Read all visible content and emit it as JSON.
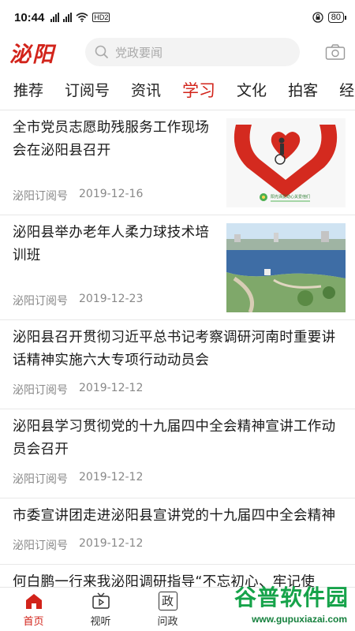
{
  "status_bar": {
    "time": "10:44",
    "network_badge": "HD2",
    "battery": "80"
  },
  "header": {
    "logo": "泌阳",
    "search_placeholder": "党政要闻",
    "camera_icon": "camera-icon"
  },
  "tabs": [
    {
      "label": "推荐",
      "active": false
    },
    {
      "label": "订阅号",
      "active": false
    },
    {
      "label": "资讯",
      "active": false
    },
    {
      "label": "学习",
      "active": true
    },
    {
      "label": "文化",
      "active": false
    },
    {
      "label": "拍客",
      "active": false
    },
    {
      "label": "经",
      "active": false
    }
  ],
  "feed": [
    {
      "title": "全市党员志愿助残服务工作现场会在泌阳县召开",
      "source": "泌阳订阅号",
      "date": "2019-12-16",
      "thumb_caption": "阳光洒爱助心关爱他们"
    },
    {
      "title": "泌阳县举办老年人柔力球技术培训班",
      "source": "泌阳订阅号",
      "date": "2019-12-23"
    },
    {
      "title": "泌阳县召开贯彻习近平总书记考察调研河南时重要讲话精神实施六大专项行动动员会",
      "source": "泌阳订阅号",
      "date": "2019-12-12"
    },
    {
      "title": "泌阳县学习贯彻党的十九届四中全会精神宣讲工作动员会召开",
      "source": "泌阳订阅号",
      "date": "2019-12-12"
    },
    {
      "title": "市委宣讲团走进泌阳县宣讲党的十九届四中全会精神",
      "source": "泌阳订阅号",
      "date": "2019-12-12"
    },
    {
      "title": "何白鹏一行来我泌阳调研指导“不忘初心、牢记使"
    }
  ],
  "bottom_nav": [
    {
      "label": "首页",
      "icon": "home-icon",
      "active": true
    },
    {
      "label": "视听",
      "icon": "tv-icon",
      "active": false
    },
    {
      "label": "问政",
      "icon": "zheng-icon",
      "glyph": "政",
      "active": false
    }
  ],
  "watermark": {
    "text": "谷普软件园",
    "url": "www.gupuxiazai.com"
  },
  "colors": {
    "accent": "#d2231a",
    "watermark": "#16a34a"
  }
}
